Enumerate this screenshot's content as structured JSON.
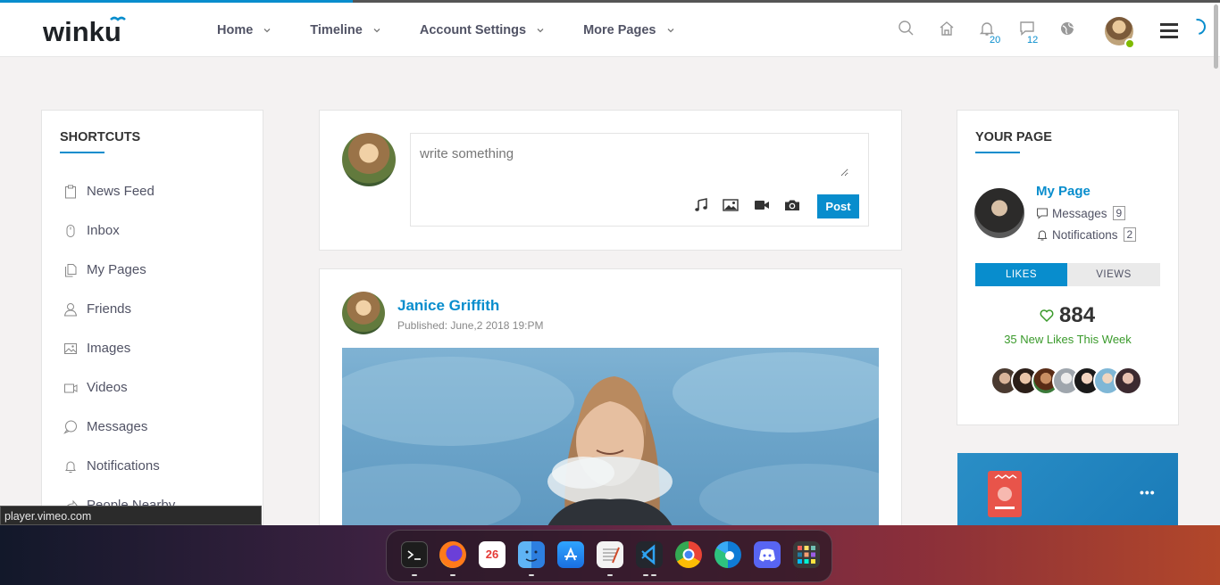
{
  "header": {
    "logo_text": "winku",
    "nav": [
      {
        "label": "Home"
      },
      {
        "label": "Timeline"
      },
      {
        "label": "Account Settings"
      },
      {
        "label": "More Pages"
      }
    ],
    "notifications_count": "20",
    "messages_count": "12"
  },
  "shortcuts": {
    "title": "SHORTCUTS",
    "items": [
      {
        "label": "News Feed",
        "icon": "clipboard-icon"
      },
      {
        "label": "Inbox",
        "icon": "mouse-icon"
      },
      {
        "label": "My Pages",
        "icon": "files-icon"
      },
      {
        "label": "Friends",
        "icon": "user-icon"
      },
      {
        "label": "Images",
        "icon": "image-icon"
      },
      {
        "label": "Videos",
        "icon": "video-icon"
      },
      {
        "label": "Messages",
        "icon": "chat-icon"
      },
      {
        "label": "Notifications",
        "icon": "bell-icon"
      },
      {
        "label": "People Nearby",
        "icon": "share-icon"
      }
    ]
  },
  "composer": {
    "placeholder": "write something",
    "post_label": "Post"
  },
  "post": {
    "author": "Janice Griffith",
    "published": "Published: June,2 2018 19:PM"
  },
  "your_page": {
    "title": "YOUR PAGE",
    "name": "My Page",
    "messages_label": "Messages",
    "messages_count": "9",
    "notifications_label": "Notifications",
    "notifications_count": "2",
    "tab_likes": "LIKES",
    "tab_views": "VIEWS",
    "likes": "884",
    "likes_week": "35 New Likes This Week"
  },
  "tooltip": "player.vimeo.com",
  "dock": {
    "calendar_day": "26"
  },
  "colors": {
    "accent": "#088dcd",
    "online": "#7fba00",
    "likes_green": "#3a9a2b"
  }
}
